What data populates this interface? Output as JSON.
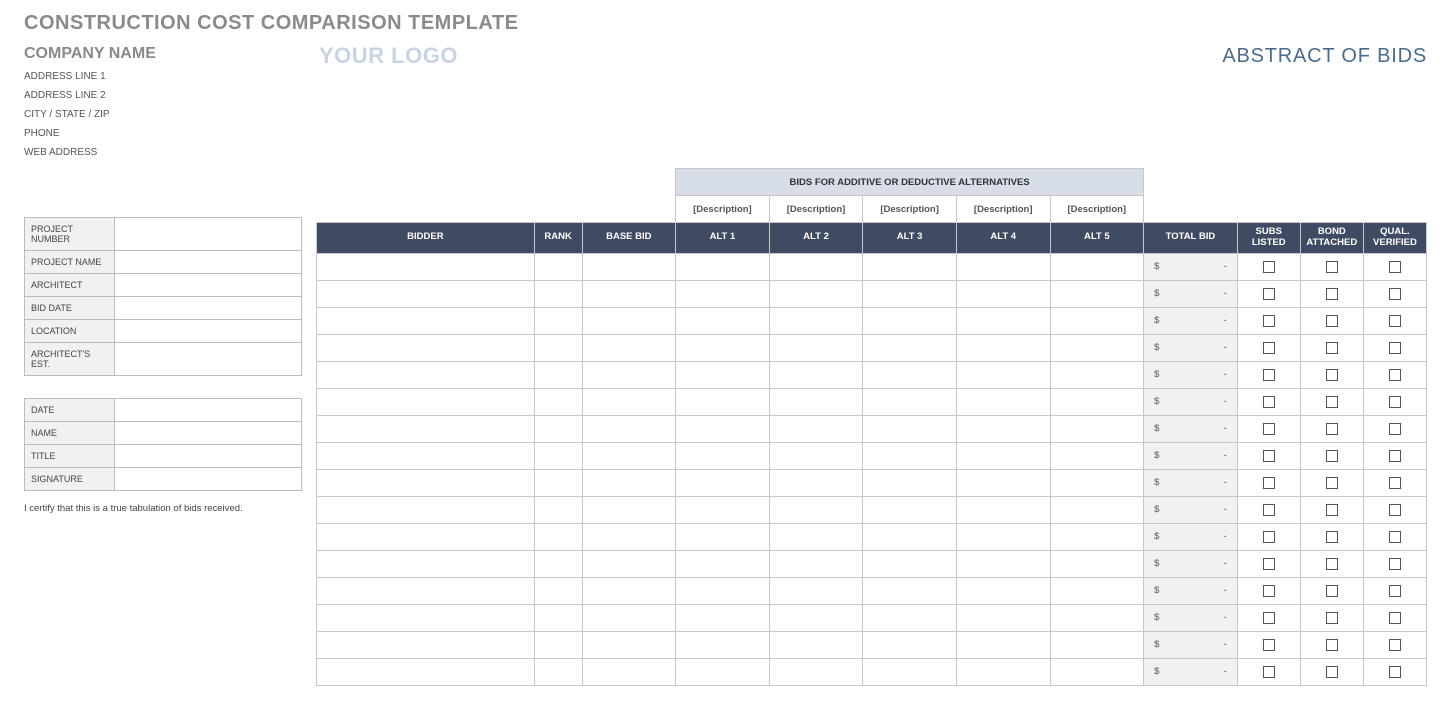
{
  "title": "CONSTRUCTION COST COMPARISON TEMPLATE",
  "company": {
    "name": "COMPANY NAME",
    "addr1": "ADDRESS LINE 1",
    "addr2": "ADDRESS LINE 2",
    "citystatezip": "CITY / STATE / ZIP",
    "phone": "PHONE",
    "web": "WEB ADDRESS"
  },
  "logo_text": "YOUR LOGO",
  "abstract_title": "ABSTRACT OF BIDS",
  "info_labels": {
    "project_number": "PROJECT NUMBER",
    "project_name": "PROJECT NAME",
    "architect": "ARCHITECT",
    "bid_date": "BID DATE",
    "location": "LOCATION",
    "architects_est": "ARCHITECT'S EST."
  },
  "info_values": {
    "project_number": "",
    "project_name": "",
    "architect": "",
    "bid_date": "",
    "location": "",
    "architects_est": ""
  },
  "sign_labels": {
    "date": "DATE",
    "name": "NAME",
    "title": "TITLE",
    "signature": "SIGNATURE"
  },
  "sign_values": {
    "date": "",
    "name": "",
    "title": "",
    "signature": ""
  },
  "certify_text": "I certify that this is a true tabulation of bids received.",
  "alt_section_title": "BIDS FOR ADDITIVE OR DEDUCTIVE ALTERNATIVES",
  "alt_descriptions": [
    "[Description]",
    "[Description]",
    "[Description]",
    "[Description]",
    "[Description]"
  ],
  "columns": {
    "bidder": "BIDDER",
    "rank": "RANK",
    "base_bid": "BASE BID",
    "alt1": "ALT 1",
    "alt2": "ALT 2",
    "alt3": "ALT 3",
    "alt4": "ALT 4",
    "alt5": "ALT 5",
    "total_bid": "TOTAL BID",
    "subs_listed": "SUBS LISTED",
    "bond_attached": "BOND ATTACHED",
    "qual_verified": "QUAL. VERIFIED"
  },
  "total_bid_display": {
    "currency": "$",
    "dash": "-"
  },
  "row_count": 16
}
